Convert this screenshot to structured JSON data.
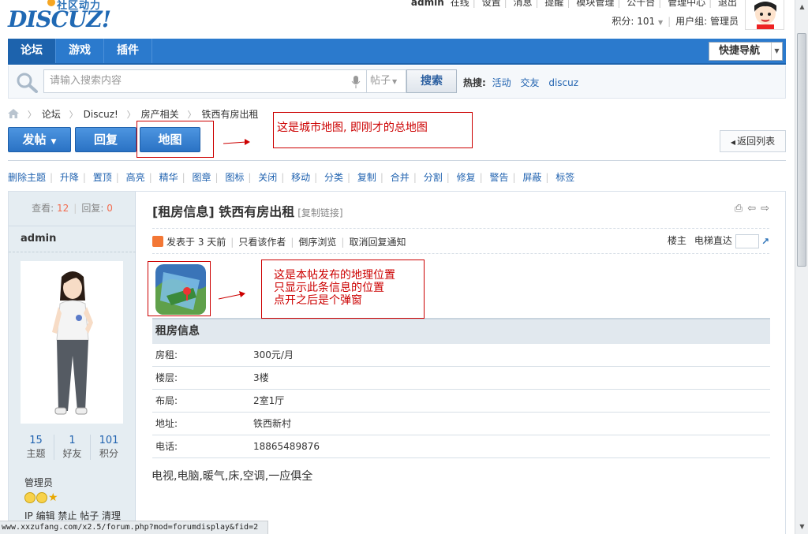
{
  "header": {
    "logo_cn": "社区动力",
    "logo_en": "DISCUZ!",
    "topnav": [
      "admin",
      "在线",
      "设置",
      "消息",
      "提醒",
      "模块管理",
      "公十台",
      "管理中心",
      "退出"
    ],
    "credits_label": "积分: 101",
    "user_group": "用户组: 管理员"
  },
  "nav": {
    "items": [
      "论坛",
      "游戏",
      "插件"
    ],
    "quicknav": "快捷导航"
  },
  "search": {
    "placeholder": "请输入搜索内容",
    "type": "帖子",
    "button": "搜索",
    "hot_label": "热搜:",
    "hot_items": [
      "活动",
      "交友",
      "discuz"
    ]
  },
  "breadcrumb": [
    "论坛",
    "Discuz!",
    "房产相关",
    "铁西有房出租"
  ],
  "actions": {
    "post": "发帖",
    "reply": "回复",
    "map": "地图",
    "back": "返回列表"
  },
  "notes": {
    "map_note": "这是城市地图, 即刚才的总地图",
    "location_note": [
      "这是本帖发布的地理位置",
      "只显示此条信息的位置",
      "点开之后是个弹窗"
    ]
  },
  "mod_actions": [
    "删除主题",
    "升降",
    "置顶",
    "高亮",
    "精华",
    "图章",
    "图标",
    "关闭",
    "移动",
    "分类",
    "复制",
    "合并",
    "分割",
    "修复",
    "警告",
    "屏蔽",
    "标签"
  ],
  "post": {
    "views_label": "查看:",
    "views": "12",
    "replies_label": "回复:",
    "replies": "0",
    "author": "admin",
    "counts": [
      {
        "value": "15",
        "label": "主题"
      },
      {
        "value": "1",
        "label": "好友"
      },
      {
        "value": "101",
        "label": "积分"
      }
    ],
    "group": "管理员",
    "admin_links": "IP 编辑 禁止 帖子 清理",
    "title": "[租房信息] 铁西有房出租",
    "copy_link": "[复制链接]",
    "meta": [
      "发表于 3 天前",
      "只看该作者",
      "倒序浏览",
      "取消回复通知"
    ],
    "floor_label": "楼主",
    "jump_label": "电梯直达",
    "info_header": "租房信息",
    "info_rows": [
      {
        "k": "房租:",
        "v": "300元/月"
      },
      {
        "k": "楼层:",
        "v": "3楼"
      },
      {
        "k": "布局:",
        "v": "2室1厅"
      },
      {
        "k": "地址:",
        "v": "铁西新村"
      },
      {
        "k": "电话:",
        "v": "18865489876"
      }
    ],
    "content": "电视,电脑,暖气,床,空调,一应俱全"
  },
  "statusbar": "www.xxzufang.com/x2.5/forum.php?mod=forumdisplay&fid=2",
  "colors": {
    "nav_blue": "#2b7acd",
    "link_blue": "#2163b0",
    "annotation_red": "#cc0000",
    "count_orange": "#f26c4f"
  }
}
